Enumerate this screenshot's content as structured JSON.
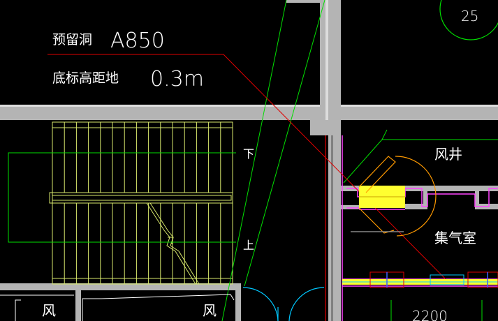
{
  "drawing": {
    "circle_tag": "25",
    "annotation": {
      "label_1": "预留洞",
      "value_1": "A850",
      "label_2": "底标高距地",
      "value_2": "0.3m"
    },
    "stair": {
      "down_label": "下",
      "up_label": "上"
    },
    "rooms": {
      "shaft": "风井",
      "plenum": "集气室",
      "wind_left": "风",
      "wind_right": "风"
    },
    "dimension": "2200",
    "colors": {
      "background": "#000000",
      "wall": "#b4b4b4",
      "stair": "#d8e86c",
      "aux_green": "#00e000",
      "leader_red": "#e00000",
      "magenta": "#ff44ff",
      "highlight_yellow": "#ffff30",
      "door_cyan": "#00c8ff",
      "door_orange": "#ff9a00"
    }
  }
}
